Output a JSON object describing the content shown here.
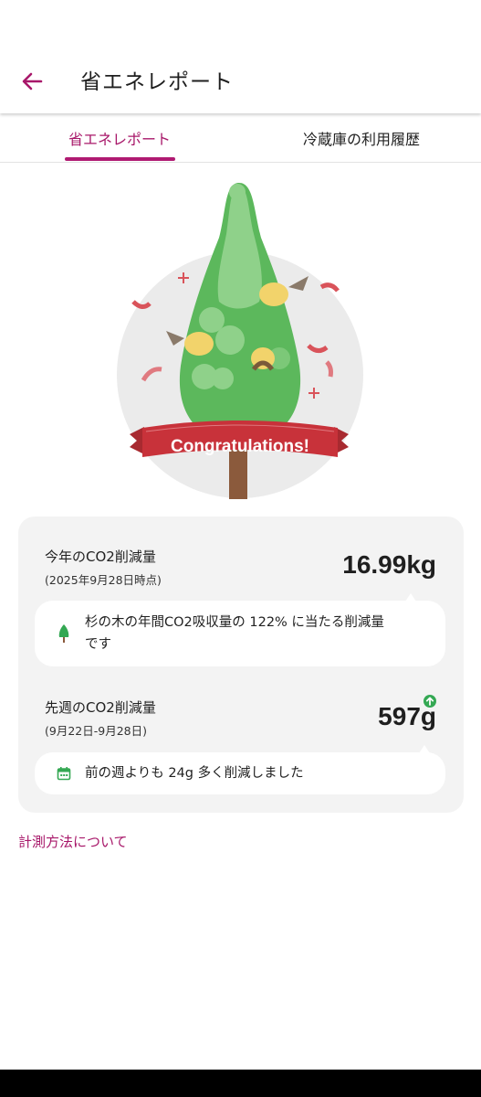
{
  "header": {
    "title": "省エネレポート"
  },
  "tabs": [
    {
      "label": "省エネレポート",
      "active": true
    },
    {
      "label": "冷蔵庫の利用履歴",
      "active": false
    }
  ],
  "hero": {
    "banner_text": "Congratulations!"
  },
  "yearly": {
    "label": "今年のCO2削減量",
    "date_note": "(2025年9月28日時点)",
    "value": "16.99kg",
    "comparison_line1": "杉の木の年間CO2吸収量の 122% に当たる削減量",
    "comparison_line2": "です",
    "icon": "tree-icon"
  },
  "weekly": {
    "label": "先週のCO2削減量",
    "date_range": "(9月22日-9月28日)",
    "value": "597g",
    "trend": "up",
    "comparison": "前の週よりも 24g 多く削減しました",
    "icon": "calendar-icon"
  },
  "footer_link": "計測方法について",
  "colors": {
    "accent": "#a8186a",
    "tree": "#5cb85c",
    "ribbon": "#c8323a",
    "trend_up": "#34a853"
  }
}
